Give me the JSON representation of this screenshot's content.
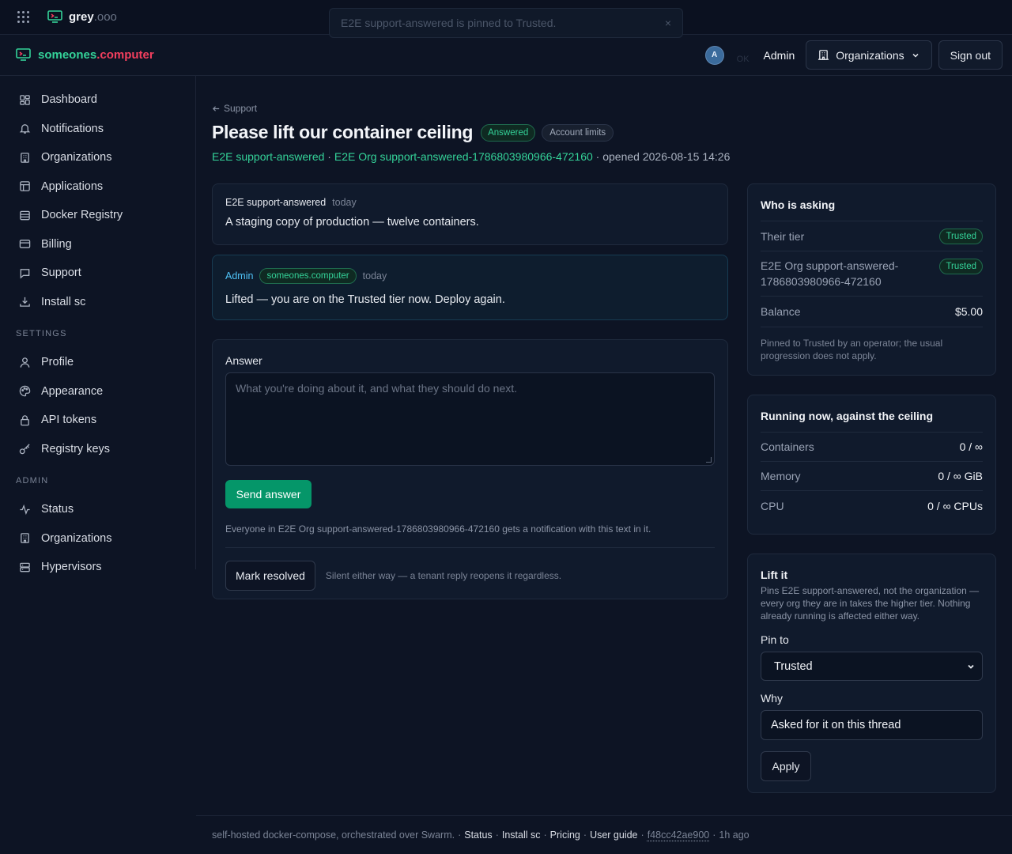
{
  "topbar": {
    "brand_name": "grey",
    "brand_suffix": ".ooo"
  },
  "toast": {
    "message": "E2E support-answered is pinned to Trusted.",
    "close": "×"
  },
  "header": {
    "brand_part1": "someones",
    "brand_part2": ".computer",
    "avatar_initial": "A",
    "ghost_text": "OK",
    "user_name": "Admin",
    "orgs_label": "Organizations",
    "signout_label": "Sign out"
  },
  "sidebar": {
    "items": [
      {
        "label": "Dashboard",
        "icon": "dashboard-icon"
      },
      {
        "label": "Notifications",
        "icon": "bell-icon"
      },
      {
        "label": "Organizations",
        "icon": "building-icon"
      },
      {
        "label": "Applications",
        "icon": "layout-icon"
      },
      {
        "label": "Docker Registry",
        "icon": "database-icon"
      },
      {
        "label": "Billing",
        "icon": "credit-card-icon"
      },
      {
        "label": "Support",
        "icon": "chat-icon"
      },
      {
        "label": "Install sc",
        "icon": "download-icon"
      }
    ],
    "settings_label": "SETTINGS",
    "settings_items": [
      {
        "label": "Profile",
        "icon": "user-icon"
      },
      {
        "label": "Appearance",
        "icon": "palette-icon"
      },
      {
        "label": "API tokens",
        "icon": "lock-icon"
      },
      {
        "label": "Registry keys",
        "icon": "key-icon"
      }
    ],
    "admin_label": "ADMIN",
    "admin_items": [
      {
        "label": "Status",
        "icon": "activity-icon"
      },
      {
        "label": "Organizations",
        "icon": "building-icon"
      },
      {
        "label": "Hypervisors",
        "icon": "server-icon"
      }
    ]
  },
  "ticket": {
    "back_label": "Support",
    "title": "Please lift our container ceiling",
    "status_badge": "Answered",
    "category_badge": "Account limits",
    "user_link": "E2E support-answered",
    "org_link": "E2E Org support-answered-1786803980966-472160",
    "opened_text": "· opened 2026-08-15 14:26",
    "separator": " · "
  },
  "messages": [
    {
      "author": "E2E support-answered",
      "when": "today",
      "body": "A staging copy of production — twelve containers."
    },
    {
      "author": "Admin",
      "org_badge": "someones.computer",
      "when": "today",
      "body": "Lifted — you are on the Trusted tier now. Deploy again."
    }
  ],
  "answer": {
    "label": "Answer",
    "placeholder": "What you're doing about it, and what they should do next.",
    "send_label": "Send answer",
    "hint": "Everyone in E2E Org support-answered-1786803980966-472160 gets a notification with this text in it.",
    "resolve_label": "Mark resolved",
    "resolve_hint": "Silent either way — a tenant reply reopens it regardless."
  },
  "who_is_asking": {
    "title": "Who is asking",
    "tier_label": "Their tier",
    "tier_value": "Trusted",
    "org_label": "E2E Org support-answered-1786803980966-472160",
    "org_value": "Trusted",
    "balance_label": "Balance",
    "balance_value": "$5.00",
    "note": "Pinned to Trusted by an operator; the usual progression does not apply."
  },
  "running": {
    "title": "Running now, against the ceiling",
    "rows": [
      {
        "label": "Containers",
        "value": "0 / ∞"
      },
      {
        "label": "Memory",
        "value": "0 / ∞ GiB"
      },
      {
        "label": "CPU",
        "value": "0 / ∞ CPUs"
      }
    ]
  },
  "lift": {
    "title": "Lift it",
    "description": "Pins E2E support-answered, not the organization — every org they are in takes the higher tier. Nothing already running is affected either way.",
    "pin_label": "Pin to",
    "pin_value": "Trusted",
    "why_label": "Why",
    "why_value": "Asked for it on this thread",
    "apply_label": "Apply"
  },
  "footer": {
    "text": "self-hosted docker-compose, orchestrated over Swarm.",
    "links": [
      "Status",
      "Install sc",
      "Pricing",
      "User guide"
    ],
    "hash": "f48cc42ae900",
    "age": "1h ago",
    "dot": "·"
  },
  "colors": {
    "accent_green": "#34d399",
    "brand_red": "#f43f5e",
    "button_green": "#059669",
    "admin_blue": "#4fc3f7",
    "background": "#0d1424"
  }
}
